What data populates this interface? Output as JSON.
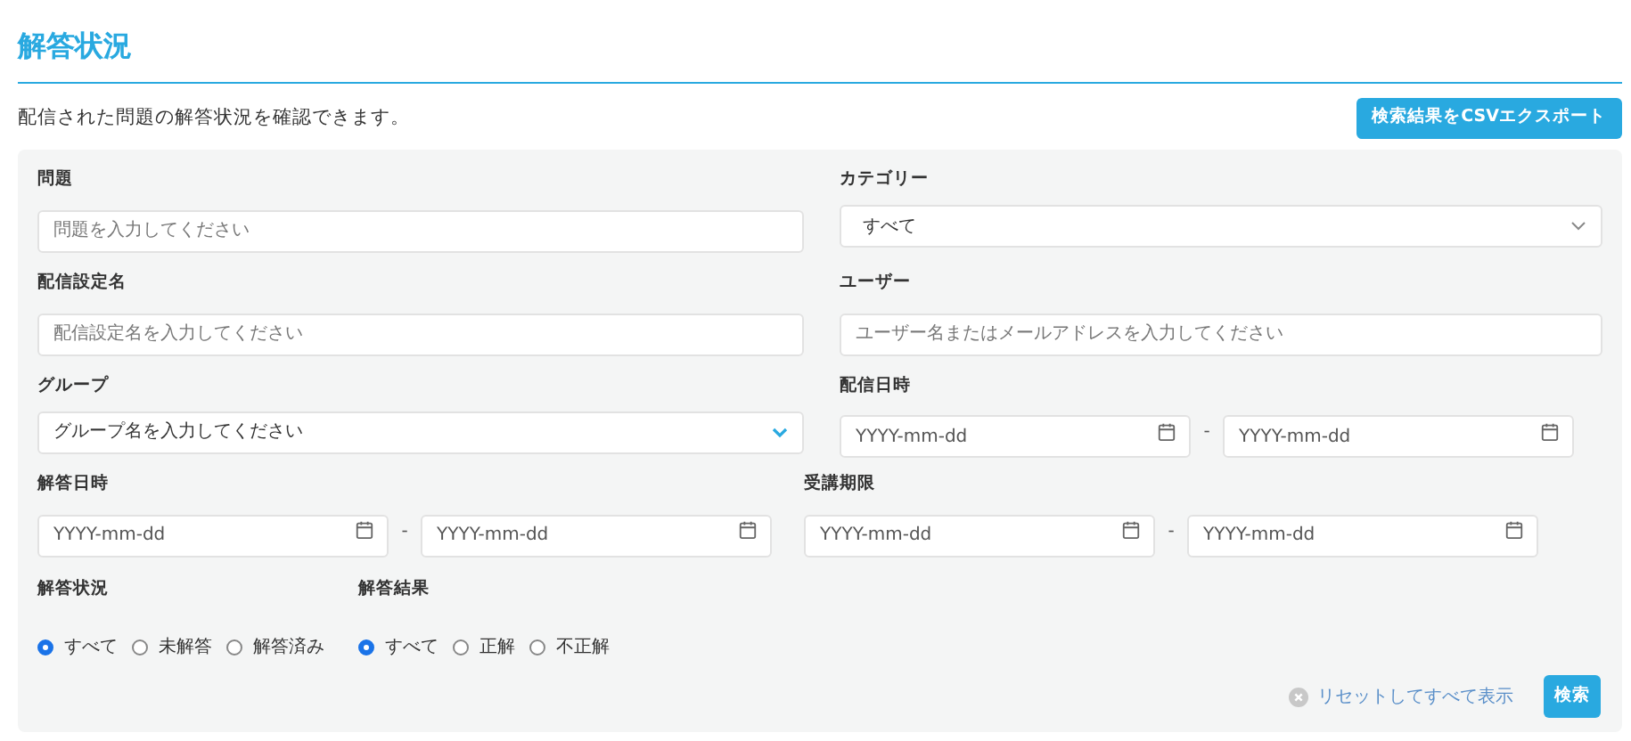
{
  "title": "解答状況",
  "description": "配信された問題の解答状況を確認できます。",
  "export_button": "検索結果をCSVエクスポート",
  "fields": [
    {
      "kind": "text",
      "label": "問題",
      "placeholder": "問題を入力してください"
    },
    {
      "kind": "select",
      "label": "カテゴリー",
      "value": "すべて"
    },
    {
      "kind": "text",
      "label": "配信設定名",
      "placeholder": "配信設定名を入力してください"
    },
    {
      "kind": "text",
      "label": "ユーザー",
      "placeholder": "ユーザー名またはメールアドレスを入力してください"
    },
    {
      "kind": "combobox",
      "label": "グループ",
      "value": "グループ名を入力してください"
    },
    {
      "kind": "date_range",
      "label": "配信日時",
      "from_placeholder": "YYYY-mm-dd",
      "separator": "-",
      "to_placeholder": "YYYY-mm-dd"
    },
    {
      "kind": "date_range",
      "label": "解答日時",
      "from_placeholder": "YYYY-mm-dd",
      "separator": "-",
      "to_placeholder": "YYYY-mm-dd"
    },
    {
      "kind": "date_range",
      "label": "受講期限",
      "from_placeholder": "YYYY-mm-dd",
      "separator": "-",
      "to_placeholder": "YYYY-mm-dd"
    }
  ],
  "radio_groups": [
    {
      "label": "解答状況",
      "options": [
        {
          "label": "すべて",
          "selected": true
        },
        {
          "label": "未解答",
          "selected": false
        },
        {
          "label": "解答済み",
          "selected": false
        }
      ]
    },
    {
      "label": "解答結果",
      "options": [
        {
          "label": "すべて",
          "selected": true
        },
        {
          "label": "正解",
          "selected": false
        },
        {
          "label": "不正解",
          "selected": false
        }
      ]
    }
  ],
  "reset_link": "リセットしてすべて表示",
  "search_button": "検索"
}
